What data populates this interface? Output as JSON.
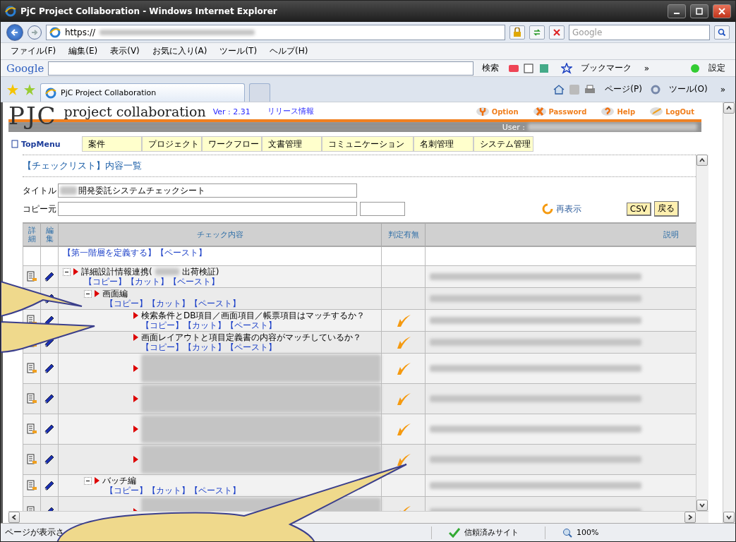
{
  "window": {
    "title": "PjC Project Collaboration - Windows Internet Explorer"
  },
  "address_bar": {
    "url": "https://",
    "search_placeholder": "Google"
  },
  "menu": [
    "ファイル(F)",
    "編集(E)",
    "表示(V)",
    "お気に入り(A)",
    "ツール(T)",
    "ヘルプ(H)"
  ],
  "google_toolbar": {
    "logo": "Google",
    "search_label": "検索",
    "bookmarks": "ブックマーク",
    "more": "»",
    "settings": "設定"
  },
  "tabs": [
    {
      "label": "PjC Project Collaboration",
      "selected": true
    }
  ],
  "command_bar": {
    "page": "ページ(P)",
    "tools": "ツール(O)",
    "more": "»"
  },
  "app": {
    "logo": "PJC",
    "product": "project collaboration",
    "version": "Ver : 2.31",
    "release_link": "リリース情報",
    "header_links": [
      {
        "label": "Option",
        "kind": "wrench"
      },
      {
        "label": "Password",
        "kind": "cross"
      },
      {
        "label": "Help",
        "kind": "help"
      },
      {
        "label": "LogOut",
        "kind": "pencil"
      }
    ],
    "user_label": "User :",
    "top_menu": "TopMenu",
    "nav": [
      "案件",
      "プロジェクト",
      "ワークフロー",
      "文書管理",
      "コミュニケーション",
      "名刺管理",
      "システム管理"
    ]
  },
  "page": {
    "heading": "【チェックリスト】内容一覧",
    "title_field": {
      "label": "タイトル",
      "value": "開発委託システムチェックシート"
    },
    "copy_field": {
      "label": "コピー元"
    },
    "refresh": "再表示",
    "buttons": [
      "CSV",
      "戻る"
    ]
  },
  "table": {
    "columns": [
      "詳細",
      "編集",
      "チェック内容",
      "判定有無",
      "説明"
    ],
    "root_actions": [
      "【第一階層を定義する】",
      "【ペースト】"
    ],
    "rows": [
      {
        "kind": "group",
        "title": "詳細設計情報連携(",
        "title_end": "出荷検証)",
        "expanded": true,
        "judged": false,
        "actions": [
          "【コピー】",
          "【カット】",
          "【ペースト】"
        ],
        "children": [
          {
            "kind": "group",
            "title": "画面編",
            "expanded": true,
            "judged": false,
            "actions": [
              "【コピー】",
              "【カット】",
              "【ペースト】"
            ],
            "children": [
              {
                "kind": "item",
                "title": "検索条件とDB項目／画面項目／帳票項目はマッチするか？",
                "judged": true,
                "actions": [
                  "【コピー】",
                  "【カット】",
                  "【ペースト】"
                ]
              },
              {
                "kind": "item",
                "title": "画面レイアウトと項目定義書の内容がマッチしているか？",
                "judged": true,
                "actions": [
                  "【コピー】",
                  "【カット】",
                  "【ペースト】"
                ]
              },
              {
                "kind": "redacted",
                "judged": true
              },
              {
                "kind": "redacted",
                "judged": true
              },
              {
                "kind": "redacted",
                "judged": true
              },
              {
                "kind": "redacted",
                "judged": true
              }
            ]
          },
          {
            "kind": "group",
            "title": "バッチ編",
            "expanded": true,
            "judged": false,
            "actions": [
              "【コピー】",
              "【カット】",
              "【ペースト】"
            ],
            "children": [
              {
                "kind": "redacted",
                "judged": true
              }
            ]
          }
        ]
      }
    ]
  },
  "status_bar": {
    "text": "ページが表示さ",
    "zone": "信頼済みサイト",
    "zoom": "100%"
  }
}
